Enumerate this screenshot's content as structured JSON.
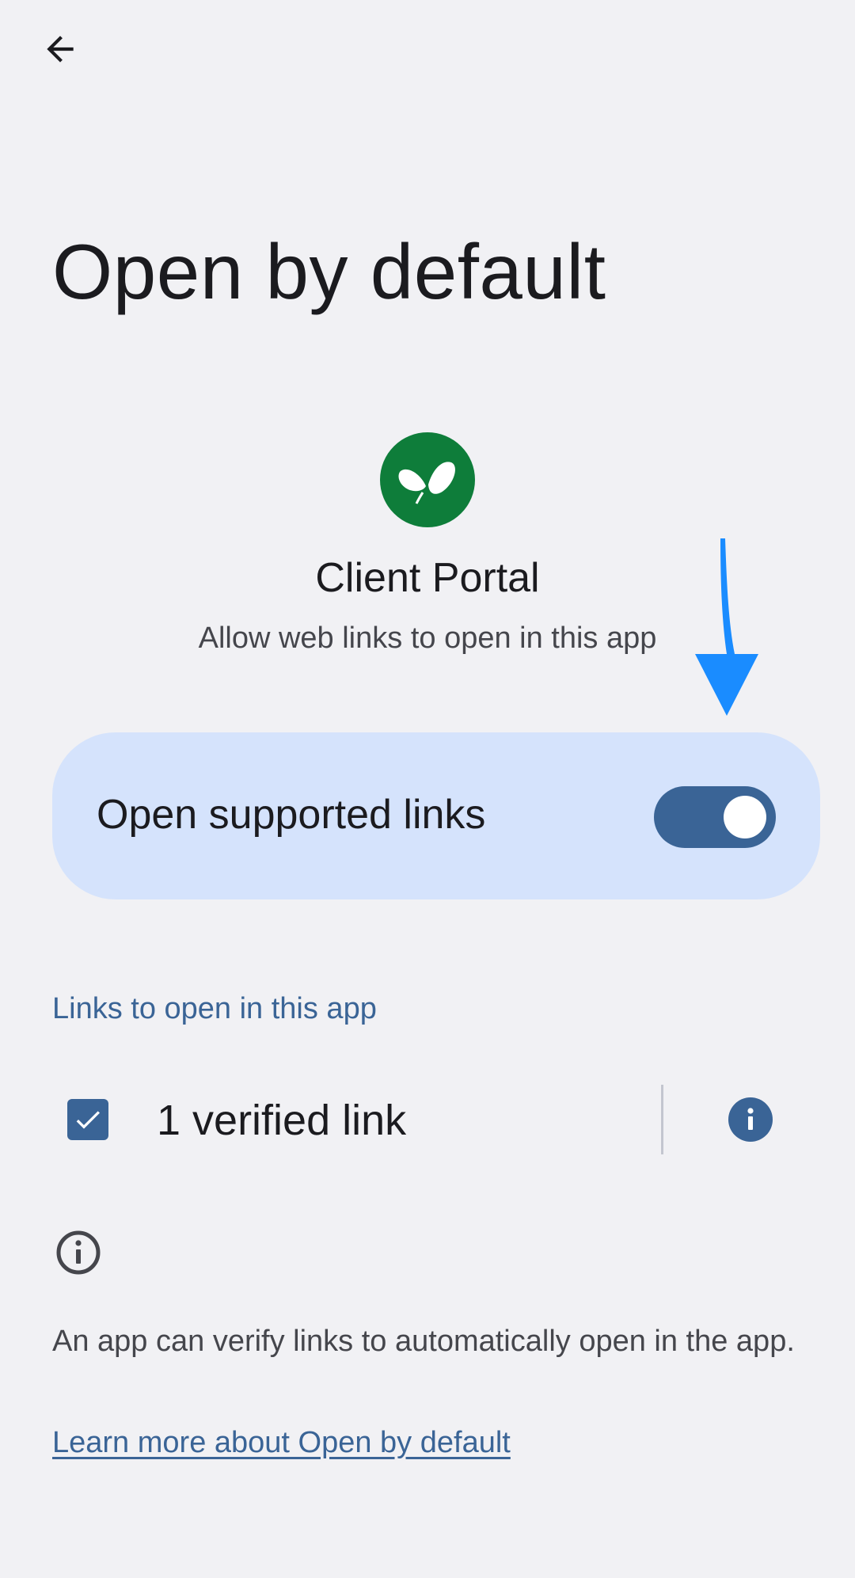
{
  "header": {
    "back_icon": "arrow-back-icon",
    "title": "Open by default"
  },
  "app": {
    "icon": "butterfly-icon",
    "icon_color": "#0e7d3a",
    "name": "Client Portal",
    "subtitle": "Allow web links to open in this app"
  },
  "toggle": {
    "label": "Open supported links",
    "state": "on",
    "card_color": "#d5e3fc",
    "switch_color": "#3a6496"
  },
  "links_section": {
    "header": "Links to open in this app",
    "verified_label": "1 verified link",
    "checked": true,
    "info_icon": "info-filled-icon"
  },
  "footer": {
    "info_icon": "info-outline-icon",
    "text": "An app can verify links to automatically open in the app.",
    "learn_more": "Learn more about Open by default"
  },
  "colors": {
    "background": "#f1f1f4",
    "accent": "#3a6496",
    "annotation_arrow": "#1a8cff"
  }
}
